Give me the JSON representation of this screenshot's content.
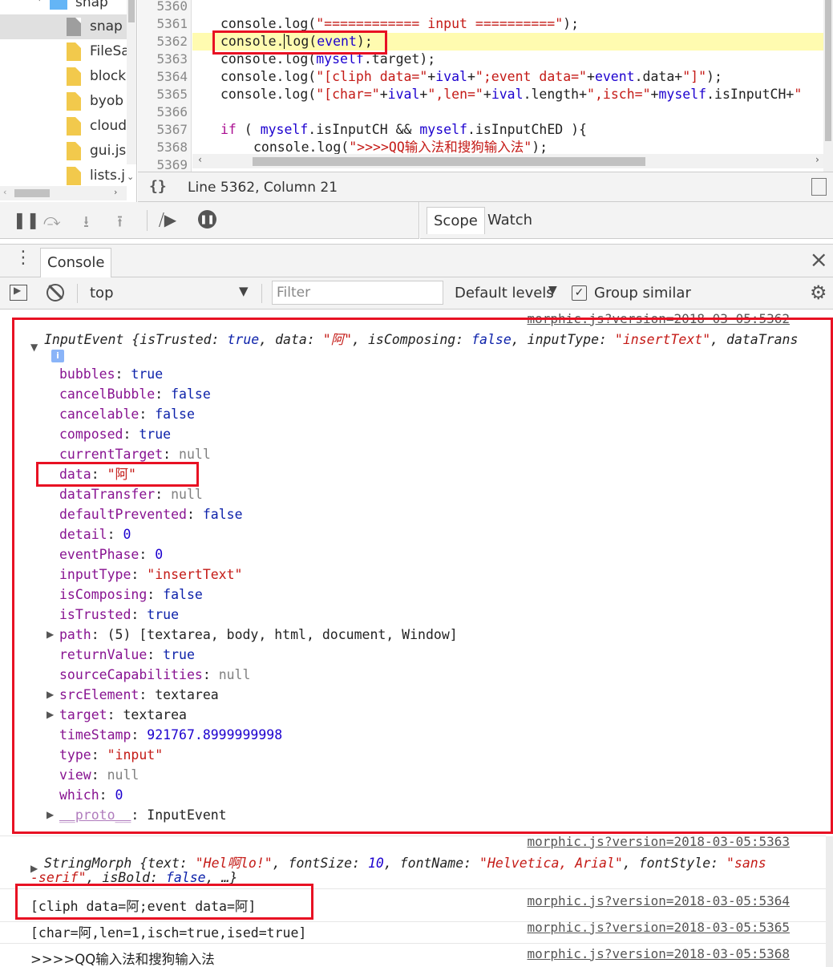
{
  "file_tree": {
    "folder": "snap",
    "items": [
      {
        "label": "snap",
        "selected": true,
        "icon": "file-icon-grey"
      },
      {
        "label": "FileSa",
        "icon": "js-file-icon"
      },
      {
        "label": "block",
        "icon": "js-file-icon"
      },
      {
        "label": "byob",
        "icon": "js-file-icon"
      },
      {
        "label": "cloud",
        "icon": "js-file-icon"
      },
      {
        "label": "gui.js",
        "icon": "js-file-icon"
      },
      {
        "label": "lists.j",
        "icon": "js-file-icon"
      }
    ]
  },
  "editor": {
    "line_numbers": [
      "5360",
      "5361",
      "5362",
      "5363",
      "5364",
      "5365",
      "5366",
      "5367",
      "5368",
      "5369"
    ],
    "highlighted_line": "5362"
  },
  "status_bar": {
    "pretty_print": "{}",
    "cursor_position": "Line 5362, Column 21"
  },
  "sidebar_tabs": {
    "scope": "Scope",
    "watch": "Watch"
  },
  "drawer": {
    "tab": "Console",
    "close": "×"
  },
  "console_toolbar": {
    "context": "top",
    "filter_placeholder": "Filter",
    "levels": "Default levels",
    "group_similar": "Group similar",
    "group_similar_checked": true
  },
  "console_messages": {
    "msg1_source": "morphic.js?version=2018-03-05:5362",
    "msg1_summary": "InputEvent {isTrusted: true, data: \"阿\", isComposing: false, inputType: \"insertText\", dataTrans",
    "msg1_properties": [
      {
        "key": "bubbles",
        "value": "true",
        "kind": "bool"
      },
      {
        "key": "cancelBubble",
        "value": "false",
        "kind": "bool"
      },
      {
        "key": "cancelable",
        "value": "false",
        "kind": "bool"
      },
      {
        "key": "composed",
        "value": "true",
        "kind": "bool"
      },
      {
        "key": "currentTarget",
        "value": "null",
        "kind": "null"
      },
      {
        "key": "data",
        "value": "\"阿\"",
        "kind": "str"
      },
      {
        "key": "dataTransfer",
        "value": "null",
        "kind": "null"
      },
      {
        "key": "defaultPrevented",
        "value": "false",
        "kind": "bool"
      },
      {
        "key": "detail",
        "value": "0",
        "kind": "num"
      },
      {
        "key": "eventPhase",
        "value": "0",
        "kind": "num"
      },
      {
        "key": "inputType",
        "value": "\"insertText\"",
        "kind": "str"
      },
      {
        "key": "isComposing",
        "value": "false",
        "kind": "bool"
      },
      {
        "key": "isTrusted",
        "value": "true",
        "kind": "bool"
      },
      {
        "key": "path",
        "value": "(5) [textarea, body, html, document, Window]",
        "kind": "obj",
        "expandable": true
      },
      {
        "key": "returnValue",
        "value": "true",
        "kind": "bool"
      },
      {
        "key": "sourceCapabilities",
        "value": "null",
        "kind": "null"
      },
      {
        "key": "srcElement",
        "value": "textarea",
        "kind": "obj",
        "expandable": true
      },
      {
        "key": "target",
        "value": "textarea",
        "kind": "obj",
        "expandable": true
      },
      {
        "key": "timeStamp",
        "value": "921767.8999999998",
        "kind": "num"
      },
      {
        "key": "type",
        "value": "\"input\"",
        "kind": "str"
      },
      {
        "key": "view",
        "value": "null",
        "kind": "null"
      },
      {
        "key": "which",
        "value": "0",
        "kind": "num"
      },
      {
        "key": "__proto__",
        "value": "InputEvent",
        "kind": "obj",
        "expandable": true,
        "dim": true
      }
    ],
    "msg2_source": "morphic.js?version=2018-03-05:5363",
    "msg2_line1": "StringMorph {text: \"Hel啊lo!\", fontSize: 10, fontName: \"Helvetica, Arial\", fontStyle: \"sans",
    "msg2_line2": "-serif\", isBold: false, …}",
    "msg3_source": "morphic.js?version=2018-03-05:5364",
    "msg3_text": "[cliph data=阿;event data=阿]",
    "msg4_source": "morphic.js?version=2018-03-05:5365",
    "msg4_text": "[char=阿,len=1,isch=true,ised=true]",
    "msg5_source": "morphic.js?version=2018-03-05:5368",
    "msg5_text": ">>>>QQ输入法和搜狗输入法"
  },
  "colors": {
    "highlight_line": "#fffbb0",
    "annotation_red": "#e81123",
    "string": "#c41a16",
    "keyword": "#aa0d91",
    "property_key": "#881391"
  }
}
